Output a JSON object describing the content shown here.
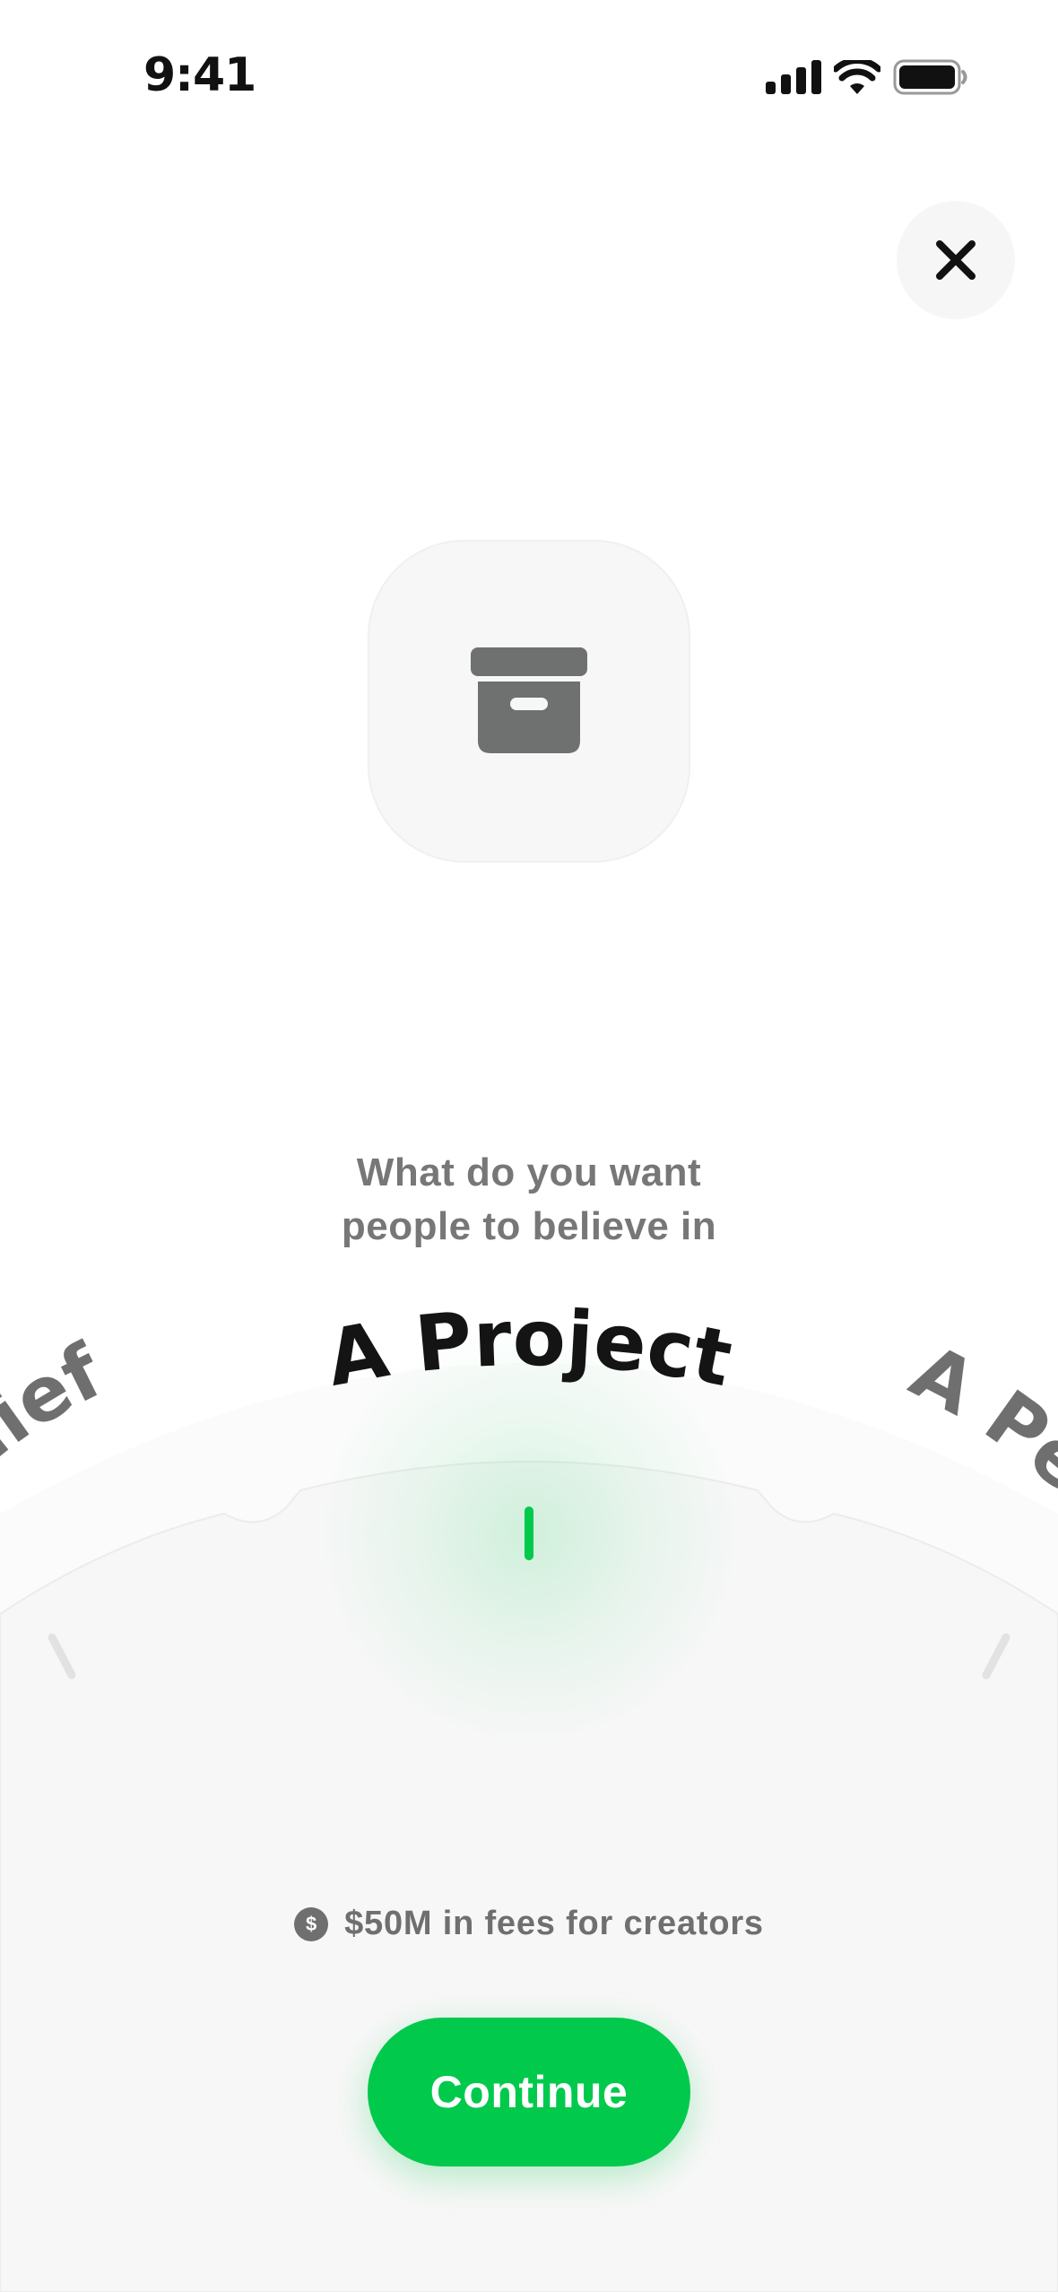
{
  "status_bar": {
    "time": "9:41",
    "icons": [
      "cellular-signal-icon",
      "wifi-icon",
      "battery-icon"
    ]
  },
  "header": {
    "close_icon": "close-icon"
  },
  "hero": {
    "icon": "archive-box-icon"
  },
  "prompt": {
    "line1": "What do you want",
    "line2": "people to believe in"
  },
  "dial": {
    "selected": "A Project",
    "left_partial": "lief",
    "right_partial": "A Pe",
    "accent_color": "#00c94c"
  },
  "footer": {
    "fees_icon_glyph": "$",
    "fees_text": "$50M in fees for creators",
    "continue_label": "Continue"
  }
}
